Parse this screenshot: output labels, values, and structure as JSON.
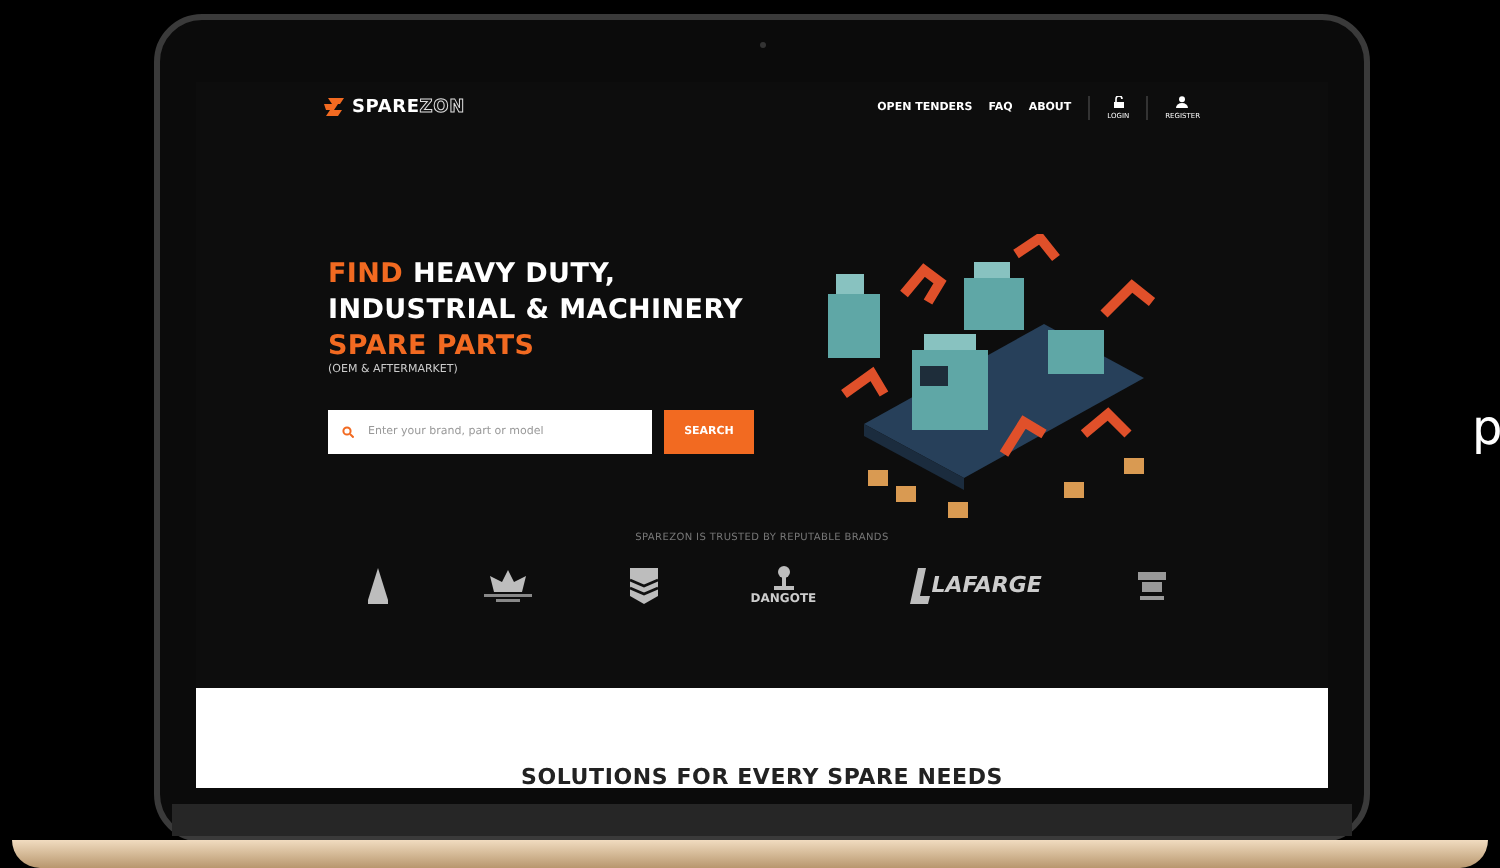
{
  "nav": {
    "logo": [
      "SPARE",
      "ZON"
    ],
    "links": [
      {
        "label": "OPEN TENDERS"
      },
      {
        "label": "FAQ"
      },
      {
        "label": "ABOUT"
      }
    ],
    "account": [
      {
        "kind": "lock",
        "label": "LOGIN"
      },
      {
        "kind": "user",
        "label": "REGISTER"
      }
    ]
  },
  "hero": {
    "heading": [
      [
        {
          "text": "FIND",
          "accent": true
        },
        {
          "text": "HEAVY DUTY,",
          "accent": false
        }
      ],
      [
        {
          "text": "INDUSTRIAL & MACHINERY",
          "accent": false
        }
      ],
      [
        {
          "text": "SPARE PARTS",
          "accent": true
        }
      ]
    ],
    "subtitle": "(OEM & AFTERMARKET)",
    "search": {
      "placeholder": "Enter your brand, part or model",
      "button": "SEARCH"
    }
  },
  "brands": {
    "title": "SPAREZON IS TRUSTED BY REPUTABLE BRANDS",
    "items": [
      {
        "kind": "bell"
      },
      {
        "kind": "leaf"
      },
      {
        "kind": "shield"
      },
      {
        "kind": "figure",
        "label": "DANGOTE"
      },
      {
        "kind": "wordmark",
        "label": "LAFARGE"
      },
      {
        "kind": "nest"
      }
    ]
  },
  "solutions": {
    "title": "SOLUTIONS FOR EVERY SPARE NEEDS"
  },
  "side_text": "p"
}
